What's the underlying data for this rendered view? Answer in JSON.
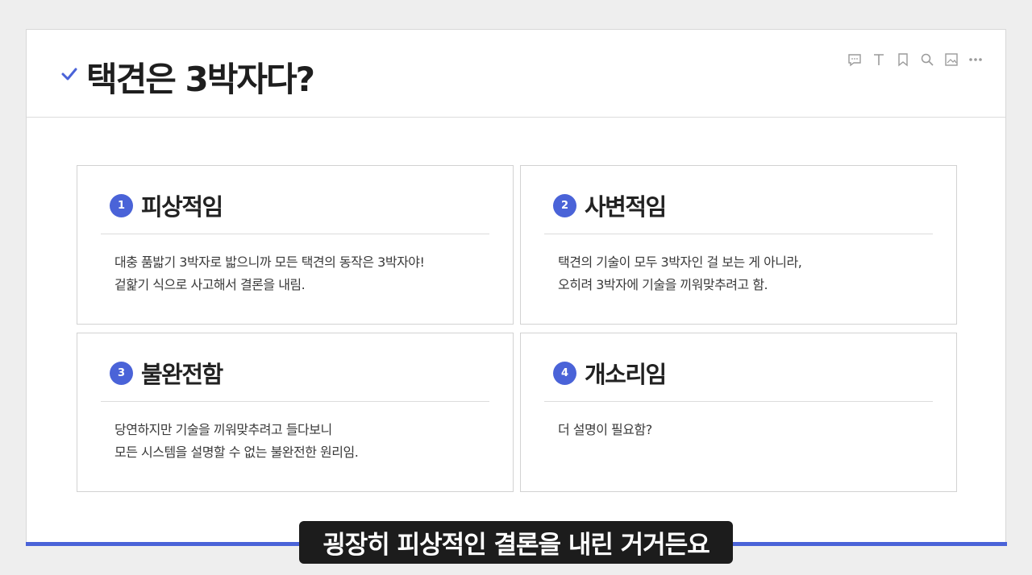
{
  "slide": {
    "title": "택견은 3박자다?",
    "toolbar": [
      {
        "icon": "comment-icon"
      },
      {
        "icon": "text-icon"
      },
      {
        "icon": "bookmark-icon"
      },
      {
        "icon": "search-icon"
      },
      {
        "icon": "image-icon"
      },
      {
        "icon": "more-icon"
      }
    ],
    "cards": [
      {
        "number": "1",
        "title": "피상적임",
        "lines": [
          "대충 품밟기 3박자로 밟으니까 모든 택견의 동작은 3박자야!",
          "겉핥기 식으로 사고해서 결론을 내림."
        ]
      },
      {
        "number": "2",
        "title": "사변적임",
        "lines": [
          "택견의 기술이 모두 3박자인 걸 보는 게 아니라,",
          "오히려 3박자에 기술을 끼워맞추려고 함."
        ]
      },
      {
        "number": "3",
        "title": "불완전함",
        "lines": [
          "당연하지만 기술을 끼워맞추려고 들다보니",
          "모든 시스템을 설명할 수 없는 불완전한 원리임."
        ]
      },
      {
        "number": "4",
        "title": "개소리임",
        "lines": [
          "더 설명이 필요함?"
        ]
      }
    ]
  },
  "subtitle": "굉장히 피상적인 결론을 내린 거거든요",
  "colors": {
    "accent": "#4a63d8",
    "subtitle_bg": "#1c1c1c"
  }
}
